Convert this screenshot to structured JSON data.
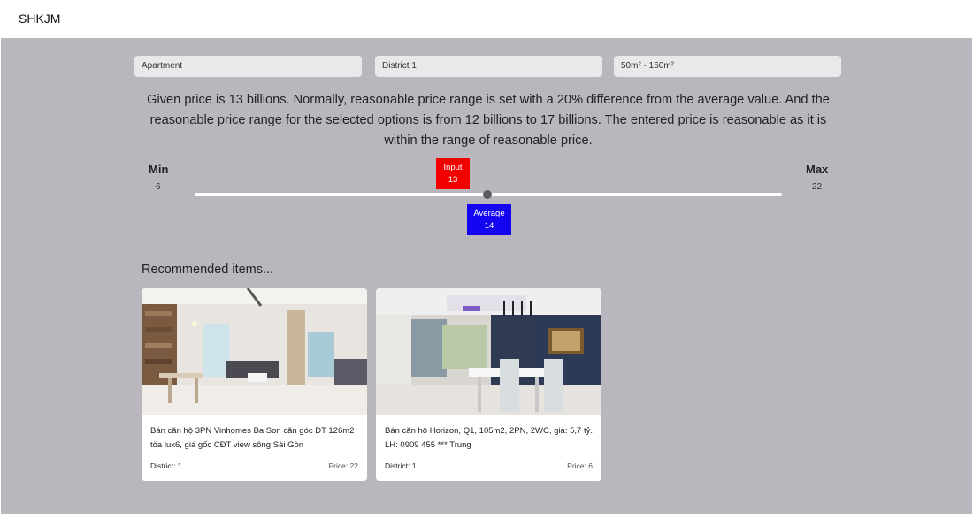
{
  "brand": "SHKJM",
  "filters": {
    "type": "Apartment",
    "district": "District 1",
    "area": "50m² - 150m²"
  },
  "description": "Given price is 13 billions. Normally, reasonable price range is set with a 20% difference from the average value. And the reasonable price range for the selected options is from 12 billions to 17 billions. The entered price is reasonable as it is within the range of reasonable price.",
  "range": {
    "min_label": "Min",
    "min_value": "6",
    "max_label": "Max",
    "max_value": "22",
    "input_label": "Input",
    "input_value": "13",
    "average_label": "Average",
    "average_value": "14"
  },
  "recommended": {
    "title": "Recommended items...",
    "items": [
      {
        "text": "Bán căn hộ 3PN Vinhomes Ba Son căn góc DT 126m2 tòa lux6, giá gốc CĐT view sông Sài Gòn",
        "district": "District: 1",
        "price": "Price: 22"
      },
      {
        "text": "Bán căn hộ Horizon, Q1, 105m2, 2PN, 2WC, giá: 5,7 tỷ. LH: 0909 455 *** Trung",
        "district": "District: 1",
        "price": "Price: 6"
      }
    ]
  }
}
